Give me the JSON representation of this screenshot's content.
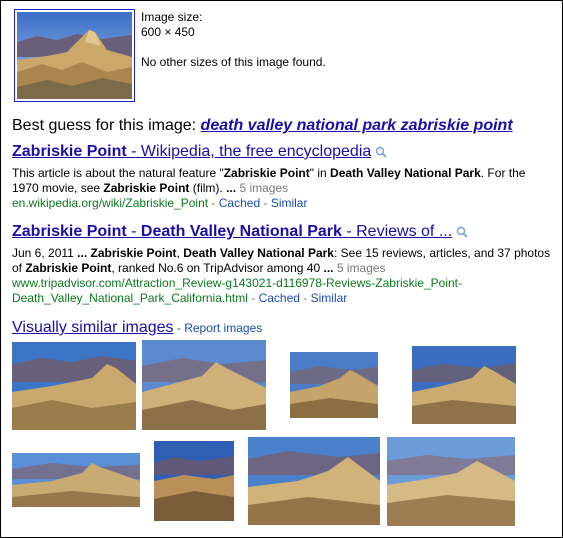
{
  "image_info": {
    "size_label": "Image size:",
    "size_value": "600 × 450",
    "other_sizes": "No other sizes of this image found."
  },
  "best_guess": {
    "prefix": "Best guess for this image:",
    "link": "death valley national park zabriskie point"
  },
  "results": [
    {
      "title_bold": "Zabriskie Point",
      "title_rest": " - Wikipedia, the free encyclopedia",
      "snippet_parts": [
        {
          "t": "This article is about the natural feature \"",
          "b": false
        },
        {
          "t": "Zabriskie Point",
          "b": true
        },
        {
          "t": "\" in ",
          "b": false
        },
        {
          "t": "Death Valley National Park",
          "b": true
        },
        {
          "t": ". For the 1970 movie, see ",
          "b": false
        },
        {
          "t": "Zabriskie Point",
          "b": true
        },
        {
          "t": " (film). ",
          "b": false
        },
        {
          "t": "...",
          "b": true
        }
      ],
      "images_count": "5 images",
      "url_line1": "en.wikipedia.org/wiki/Zabriskie_Point",
      "url_line2": "",
      "cached": "Cached",
      "similar": "Similar",
      "sep": " - "
    },
    {
      "title_bold": "Zabriskie Point",
      "title_mid": " - ",
      "title_bold2": "Death Valley National Park",
      "title_rest": " - Reviews of ...",
      "snippet_parts": [
        {
          "t": "Jun 6, 2011 ",
          "b": false
        },
        {
          "t": "...",
          "b": true
        },
        {
          "t": " ",
          "b": false
        },
        {
          "t": "Zabriskie Point",
          "b": true
        },
        {
          "t": ", ",
          "b": false
        },
        {
          "t": "Death Valley National Park",
          "b": true
        },
        {
          "t": ": See 15 reviews, articles, and 37 photos of ",
          "b": false
        },
        {
          "t": "Zabriskie Point",
          "b": true
        },
        {
          "t": ", ranked No.6 on TripAdvisor among 40 ",
          "b": false
        },
        {
          "t": "...",
          "b": true
        }
      ],
      "images_count": "5 images",
      "url_line1": "www.tripadvisor.com/Attraction_Review-g143021-d116978-Reviews-Zabriskie_Point-",
      "url_line2": "Death_Valley_National_Park_California.html",
      "cached": "Cached",
      "similar": "Similar",
      "sep": " - "
    }
  ],
  "visually_similar": {
    "title": "Visually similar images",
    "sep": " - ",
    "report": "Report images"
  },
  "icons": {
    "magnifier": "magnifier-icon"
  },
  "colors": {
    "link": "#1a0dab",
    "url": "#0a7a1e",
    "secondary_link": "#1a4bb5"
  }
}
